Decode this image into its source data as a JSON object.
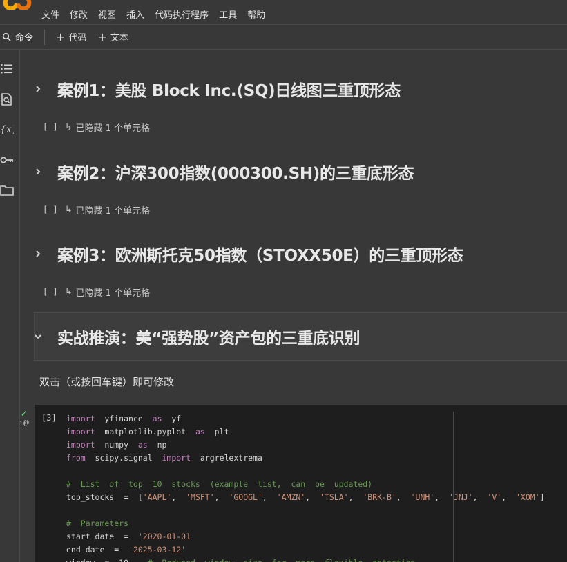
{
  "menu": [
    "文件",
    "修改",
    "视图",
    "插入",
    "代码执行程序",
    "工具",
    "帮助"
  ],
  "toolbar": {
    "command": "命令",
    "code": "代码",
    "text": "文本"
  },
  "sidebar_icons": [
    "toc-icon",
    "find-icon",
    "variables-icon",
    "secrets-icon",
    "files-icon"
  ],
  "sections": [
    {
      "title": "案例1：美股 Block Inc.(SQ)日线图三重顶形态",
      "hidden": "已隐藏 1 个单元格"
    },
    {
      "title": "案例2：沪深300指数(000300.SH)的三重底形态",
      "hidden": "已隐藏 1 个单元格"
    },
    {
      "title": "案例3：欧洲斯托克50指数（STOXX50E）的三重顶形态",
      "hidden": "已隐藏 1 个单元格"
    },
    {
      "title": "实战推演：美“强势股”资产包的三重底识别"
    }
  ],
  "hidden_bracket": "[ ]",
  "hidden_arrow": "↳",
  "edit_hint": "双击（或按回车键）即可修改",
  "cell": {
    "exec_count": "[3]",
    "run_time": "1秒",
    "lines": [
      [
        [
          "kw",
          "import"
        ],
        [
          "t",
          "  yfinance  "
        ],
        [
          "kw",
          "as"
        ],
        [
          "t",
          "  yf"
        ]
      ],
      [
        [
          "kw",
          "import"
        ],
        [
          "t",
          "  matplotlib.pyplot  "
        ],
        [
          "kw",
          "as"
        ],
        [
          "t",
          "  plt"
        ]
      ],
      [
        [
          "kw",
          "import"
        ],
        [
          "t",
          "  numpy  "
        ],
        [
          "kw",
          "as"
        ],
        [
          "t",
          "  np"
        ]
      ],
      [
        [
          "kw",
          "from"
        ],
        [
          "t",
          "  scipy.signal  "
        ],
        [
          "kw",
          "import"
        ],
        [
          "t",
          "  argrelextrema"
        ]
      ],
      [],
      [
        [
          "cm",
          "#  List  of  top  10  stocks  (example  list,  can  be  updated)"
        ]
      ],
      [
        [
          "t",
          "top_stocks  =  ["
        ],
        [
          "str",
          "'AAPL'"
        ],
        [
          "t",
          ",  "
        ],
        [
          "str",
          "'MSFT'"
        ],
        [
          "t",
          ",  "
        ],
        [
          "str",
          "'GOOGL'"
        ],
        [
          "t",
          ",  "
        ],
        [
          "str",
          "'AMZN'"
        ],
        [
          "t",
          ",  "
        ],
        [
          "str",
          "'TSLA'"
        ],
        [
          "t",
          ",  "
        ],
        [
          "str",
          "'BRK-B'"
        ],
        [
          "t",
          ",  "
        ],
        [
          "str",
          "'UNH'"
        ],
        [
          "t",
          ",  "
        ],
        [
          "str",
          "'JNJ'"
        ],
        [
          "t",
          ",  "
        ],
        [
          "str",
          "'V'"
        ],
        [
          "t",
          ",  "
        ],
        [
          "str",
          "'XOM'"
        ],
        [
          "t",
          "]"
        ]
      ],
      [],
      [
        [
          "cm",
          "#  Parameters"
        ]
      ],
      [
        [
          "t",
          "start_date  =  "
        ],
        [
          "str",
          "'2020-01-01'"
        ]
      ],
      [
        [
          "t",
          "end_date  =  "
        ],
        [
          "str",
          "'2025-03-12'"
        ]
      ],
      [
        [
          "t",
          "window  =  10    "
        ],
        [
          "cm",
          "#  Reduced  window  size  for  more  flexible  detection"
        ]
      ]
    ]
  },
  "colors": {
    "background": "#383838",
    "code_bg": "#1e1e1e",
    "keyword": "#c586c0",
    "string": "#ce9178",
    "comment": "#6a9955",
    "logo": "#f9ab00"
  }
}
